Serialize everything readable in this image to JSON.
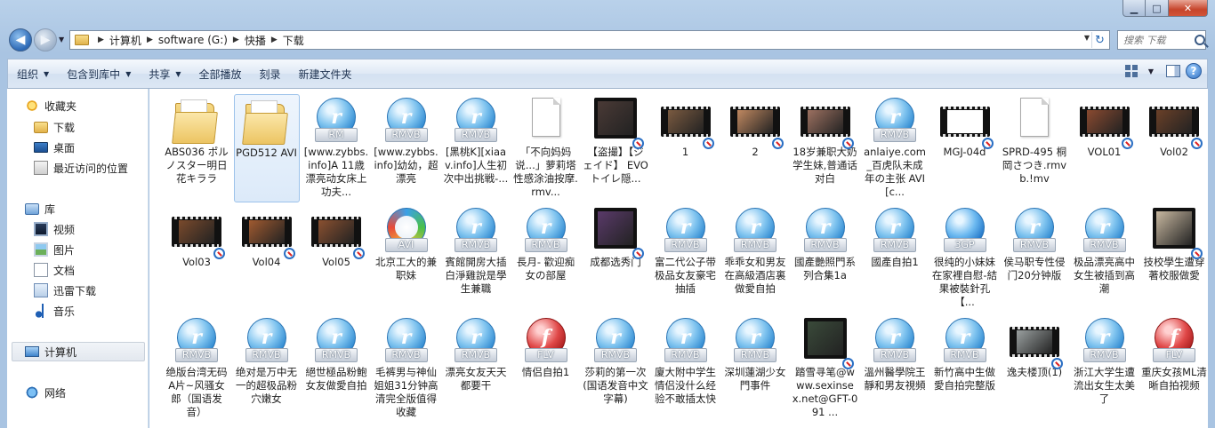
{
  "address": {
    "segments": [
      "计算机",
      "software (G:)",
      "快播",
      "下载"
    ]
  },
  "search": {
    "placeholder": "搜索 下载"
  },
  "toolbar": {
    "organize": "组织",
    "include_in_library": "包含到库中",
    "share": "共享",
    "play_all": "全部播放",
    "burn": "刻录",
    "new_folder": "新建文件夹"
  },
  "nav": {
    "favorites": "收藏夹",
    "downloads": "下载",
    "desktop": "桌面",
    "recent": "最近访问的位置",
    "libraries": "库",
    "videos": "视频",
    "pictures": "图片",
    "documents": "文档",
    "xunlei": "迅雷下载",
    "music": "音乐",
    "computer": "计算机",
    "network": "网络"
  },
  "files": [
    {
      "name": "ABS036 ポルノスター明日花キララ",
      "icon": "folder"
    },
    {
      "name": "PGD512 AVI",
      "icon": "folder"
    },
    {
      "name": "[www.zybbs.info]A 11歳漂亮动女床上功夫...",
      "icon": "rm",
      "tag": "RM"
    },
    {
      "name": "[www.zybbs.info]幼幼，超漂亮",
      "icon": "rm",
      "tag": "RMVB"
    },
    {
      "name": "[黑桃K][xiaav.info]人生初次中出挑戦-...",
      "icon": "rm",
      "tag": "RMVB"
    },
    {
      "name": "「不向妈妈说...」萝莉塔性感涂油按摩.rmv...",
      "icon": "blank"
    },
    {
      "name": "【盗撮】【ジェイド】 EVO トイレ隠...",
      "icon": "film-big",
      "thumb": "#4a3a36"
    },
    {
      "name": "1",
      "icon": "film",
      "thumb": "#7a5a40"
    },
    {
      "name": "2",
      "icon": "film",
      "thumb": "#c08860"
    },
    {
      "name": "18岁兼职大奶学生妹,普通话对白",
      "icon": "film",
      "thumb": "#9c7060"
    },
    {
      "name": "anlaiye.com_百虎队未成年の主张 AVI[c...",
      "icon": "rm",
      "tag": "RMVB"
    },
    {
      "name": "MGJ-04d",
      "icon": "film",
      "thumb": "#ffffff"
    },
    {
      "name": "SPRD-495 桐岡さつき.rmvb.!mv",
      "icon": "blank"
    },
    {
      "name": "VOL01",
      "icon": "film",
      "thumb": "#8a4a30"
    },
    {
      "name": "Vol02",
      "icon": "film",
      "thumb": "#6a4028"
    },
    {
      "name": "Vol03",
      "icon": "film",
      "thumb": "#7a4a2c"
    },
    {
      "name": "Vol04",
      "icon": "film",
      "thumb": "#a05a30"
    },
    {
      "name": "Vol05",
      "icon": "film",
      "thumb": "#8a5030"
    },
    {
      "name": "北京工大的兼职妹",
      "icon": "avi",
      "tag": "AVI"
    },
    {
      "name": "賓館開房大插白淨雞說是學生兼職",
      "icon": "rm",
      "tag": "RMVB"
    },
    {
      "name": "長月- 歡迎痴女の部屋",
      "icon": "rm",
      "tag": "RMVB"
    },
    {
      "name": "成都选秀门",
      "icon": "film-big",
      "thumb": "#5a3a6a"
    },
    {
      "name": "富二代公子带极品女友豪宅抽插",
      "icon": "rm",
      "tag": "RMVB"
    },
    {
      "name": "乖乖女和男友在高級酒店裏做愛自拍",
      "icon": "rm",
      "tag": "RMVB"
    },
    {
      "name": "國產艷照門系列合集1a",
      "icon": "rm",
      "tag": "RMVB"
    },
    {
      "name": "國產自拍1",
      "icon": "rm",
      "tag": "RMVB"
    },
    {
      "name": "很纯的小妹妹在家裡自慰-結果被裝針孔【...",
      "icon": "3gp",
      "tag": "3GP"
    },
    {
      "name": "侯马职专性侵门20分钟版",
      "icon": "rm",
      "tag": "RMVB"
    },
    {
      "name": "极品漂亮高中女生被插到高潮",
      "icon": "rm",
      "tag": "RMVB"
    },
    {
      "name": "技校學生遭穿著校服做愛",
      "icon": "film-big",
      "thumb": "#c8b8a0"
    },
    {
      "name": "绝版台湾无码A片~风骚女郎（国语发音）",
      "icon": "rm",
      "tag": "RMVB"
    },
    {
      "name": "绝对是万中无一的超极品粉穴嫩女",
      "icon": "rm",
      "tag": "RMVB"
    },
    {
      "name": "絕世極品粉鮑女友做愛自拍",
      "icon": "rm",
      "tag": "RMVB"
    },
    {
      "name": "毛裤男与神仙姐姐31分钟高清完全版值得收藏",
      "icon": "rm",
      "tag": "RMVB"
    },
    {
      "name": "漂亮女友天天都要干",
      "icon": "rm",
      "tag": "RMVB"
    },
    {
      "name": "情侣自拍1",
      "icon": "flv",
      "tag": "FLV"
    },
    {
      "name": "莎莉的第一次 (国语发音中文字幕)",
      "icon": "rm",
      "tag": "RMVB"
    },
    {
      "name": "廈大附中学生情侣没什么经验不敢插太快",
      "icon": "rm",
      "tag": "RMVB"
    },
    {
      "name": "深圳蓮湖少女門事件",
      "icon": "rm",
      "tag": "RMVB"
    },
    {
      "name": "踏雪寻笔@www.sexinsex.net@GFT-091 ...",
      "icon": "film-big",
      "thumb": "#3a4a3a"
    },
    {
      "name": "溫州醫學院王靜和男友視頻",
      "icon": "rm",
      "tag": "RMVB"
    },
    {
      "name": "新竹高中生做愛自拍完整版",
      "icon": "rm",
      "tag": "RMVB"
    },
    {
      "name": "逸夫楼顶(1)",
      "icon": "film",
      "thumb": "#9aa0a0"
    },
    {
      "name": "浙江大学生遭流出女生太美了",
      "icon": "rm",
      "tag": "RMVB"
    },
    {
      "name": "重庆女孩ML清晰自拍视频",
      "icon": "flv",
      "tag": "FLV"
    }
  ],
  "selected_index": 1,
  "colors": {
    "accent": "#2c87cf",
    "selection": "#dceaf9"
  }
}
